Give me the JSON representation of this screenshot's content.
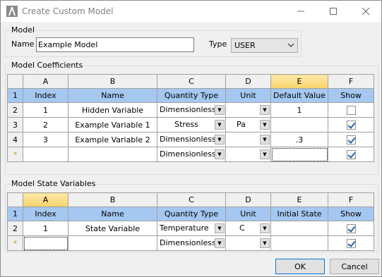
{
  "window": {
    "title": "Create Custom Model"
  },
  "model": {
    "group_label": "Model",
    "name_label": "Name",
    "name_value": "Example Model",
    "type_label": "Type",
    "type_value": "USER"
  },
  "coefficients": {
    "group_label": "Model Coefficients",
    "columns": [
      "A",
      "B",
      "C",
      "D",
      "E",
      "F"
    ],
    "headers": [
      "Index",
      "Name",
      "Quantity Type",
      "Unit",
      "Default Value",
      "Show"
    ],
    "rows": [
      {
        "row": "2",
        "index": "1",
        "name": "Hidden Variable",
        "qtype": "Dimensionless",
        "unit": "",
        "default": "1",
        "show": false
      },
      {
        "row": "3",
        "index": "2",
        "name": "Example Variable 1",
        "qtype": "Stress",
        "unit": "Pa",
        "default": "",
        "show": true
      },
      {
        "row": "4",
        "index": "3",
        "name": "Example Variable 2",
        "qtype": "Dimensionless",
        "unit": "",
        "default": ".3",
        "show": true
      },
      {
        "row": "*",
        "index": "",
        "name": "",
        "qtype": "Dimensionless",
        "unit": "",
        "default": "",
        "show": true
      }
    ]
  },
  "state_vars": {
    "group_label": "Model State Variables",
    "columns": [
      "A",
      "B",
      "C",
      "D",
      "E",
      "F"
    ],
    "headers": [
      "Index",
      "Name",
      "Quantity Type",
      "Unit",
      "Initial State",
      "Show"
    ],
    "rows": [
      {
        "row": "2",
        "index": "1",
        "name": "State Variable",
        "qtype": "Temperature",
        "unit": "C",
        "initial": "",
        "show": true
      },
      {
        "row": "*",
        "index": "",
        "name": "",
        "qtype": "Dimensionless",
        "unit": "",
        "initial": "",
        "show": true
      }
    ]
  },
  "buttons": {
    "ok": "OK",
    "cancel": "Cancel"
  }
}
